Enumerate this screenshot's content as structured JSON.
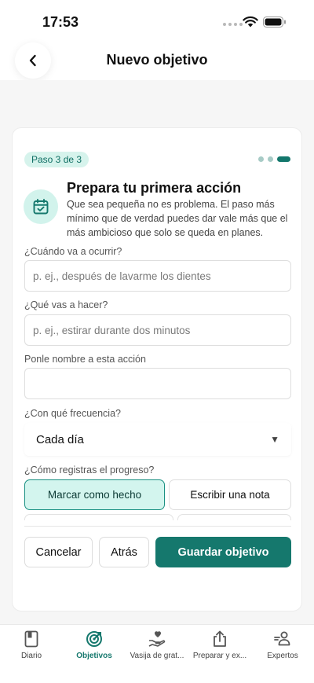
{
  "status": {
    "time": "17:53"
  },
  "nav": {
    "title": "Nuevo objetivo"
  },
  "card": {
    "step_badge": "Paso 3 de 3",
    "title": "Prepara tu primera acción",
    "description": "Que sea pequeña no es problema. El paso más mínimo que de verdad puedes dar vale más que el más ambicioso que solo se queda en planes.",
    "fields": {
      "when": {
        "label": "¿Cuándo va a ocurrir?",
        "placeholder": "p. ej., después de lavarme los dientes",
        "value": ""
      },
      "what": {
        "label": "¿Qué vas a hacer?",
        "placeholder": "p. ej., estirar durante dos minutos",
        "value": ""
      },
      "name": {
        "label": "Ponle nombre a esta acción",
        "placeholder": "",
        "value": ""
      },
      "frequency": {
        "label": "¿Con qué frecuencia?",
        "selected": "Cada día"
      },
      "progress": {
        "label": "¿Cómo registras el progreso?",
        "options": [
          "Marcar como hecho",
          "Escribir una nota"
        ],
        "selected_index": 0
      }
    },
    "buttons": {
      "cancel": "Cancelar",
      "back": "Atrás",
      "save": "Guardar objetivo"
    }
  },
  "tabs": [
    {
      "label": "Diario",
      "icon": "book-icon"
    },
    {
      "label": "Objetivos",
      "icon": "target-icon",
      "active": true
    },
    {
      "label": "Vasija de grat...",
      "icon": "heart-hand-icon"
    },
    {
      "label": "Preparar y ex...",
      "icon": "share-icon"
    },
    {
      "label": "Expertos",
      "icon": "experts-icon"
    }
  ],
  "colors": {
    "accent": "#15786d",
    "accent_light": "#d3f5ee",
    "badge_text": "#0e6e63"
  }
}
